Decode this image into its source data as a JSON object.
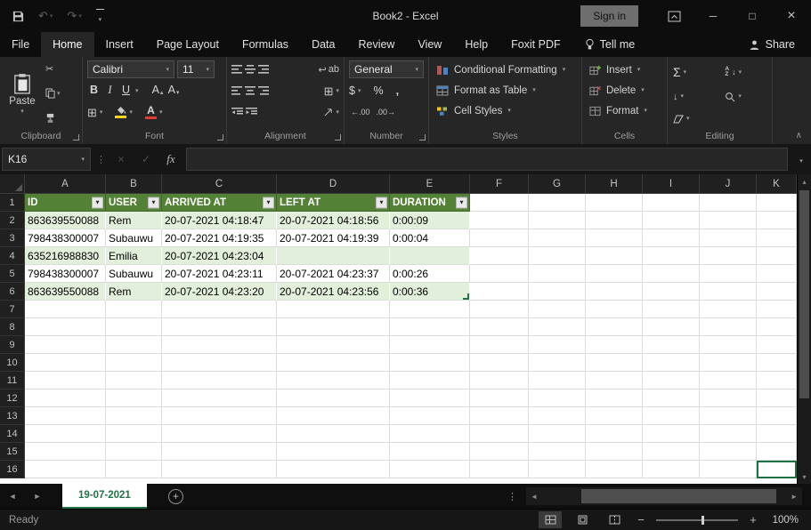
{
  "colors": {
    "excel_green": "#217346",
    "table_header_bg": "#538135",
    "table_band_bg": "#e2efda",
    "ribbon_bg": "#262626",
    "titlebar_bg": "#0d0d0d"
  },
  "icons": {
    "chevron_down": "▾",
    "chevron_up": "∧",
    "undo": "↶",
    "redo": "↷",
    "scissors": "✂",
    "dots_vertical": "⋮",
    "close": "×",
    "minimize": "─",
    "maximize": "□",
    "check": "✓",
    "sigma": "Σ",
    "tri_up": "▴",
    "tri_down": "▾",
    "tri_left": "◄",
    "tri_right": "►",
    "plus": "+",
    "minus": "−",
    "down_arrow": "↓",
    "return_arrow": "↩",
    "grid_square": "⊞",
    "fx": "fx"
  },
  "titlebar": {
    "title": "Book2 - Excel",
    "sign_in": "Sign in"
  },
  "menu": {
    "tabs": [
      "File",
      "Home",
      "Insert",
      "Page Layout",
      "Formulas",
      "Data",
      "Review",
      "View",
      "Help",
      "Foxit PDF"
    ],
    "active": "Home",
    "tell_me": "Tell me",
    "share": "Share"
  },
  "ribbon": {
    "clipboard": {
      "label": "Clipboard",
      "paste": "Paste"
    },
    "font": {
      "label": "Font",
      "family": "Calibri",
      "size": "11",
      "bold": "B",
      "italic": "I",
      "underline": "U",
      "grow": "A",
      "shrink": "A",
      "color_letter": "A"
    },
    "alignment": {
      "label": "Alignment",
      "wrap": "ab"
    },
    "number": {
      "label": "Number",
      "format": "General",
      "currency": "$",
      "percent": "%",
      "comma": ",",
      "increase_decimal": "←.00",
      "decrease_decimal": ".00→"
    },
    "styles": {
      "label": "Styles",
      "conditional": "Conditional Formatting",
      "format_table": "Format as Table",
      "cell_styles": "Cell Styles"
    },
    "cells": {
      "label": "Cells",
      "insert": "Insert",
      "delete": "Delete",
      "format": "Format"
    },
    "editing": {
      "label": "Editing",
      "sort_top": "A",
      "sort_bottom": "Z"
    }
  },
  "formula_bar": {
    "name_box": "K16",
    "value": ""
  },
  "grid": {
    "columns": [
      "A",
      "B",
      "C",
      "D",
      "E",
      "F",
      "G",
      "H",
      "I",
      "J",
      "K"
    ],
    "visible_rows": 16,
    "active_cell": "K16",
    "table": {
      "headers": [
        "ID",
        "USER",
        "ARRIVED AT",
        "LEFT AT",
        "DURATION"
      ],
      "rows": [
        [
          "863639550088",
          "Rem",
          "20-07-2021 04:18:47",
          "20-07-2021 04:18:56",
          "0:00:09"
        ],
        [
          "798438300007",
          "Subauwu",
          "20-07-2021 04:19:35",
          "20-07-2021 04:19:39",
          "0:00:04"
        ],
        [
          "635216988830",
          "Emilia",
          "20-07-2021 04:23:04",
          "",
          ""
        ],
        [
          "798438300007",
          "Subauwu",
          "20-07-2021 04:23:11",
          "20-07-2021 04:23:37",
          "0:00:26"
        ],
        [
          "863639550088",
          "Rem",
          "20-07-2021 04:23:20",
          "20-07-2021 04:23:56",
          "0:00:36"
        ]
      ]
    }
  },
  "sheet_bar": {
    "tabs": [
      "19-07-2021"
    ],
    "active_tab": "19-07-2021"
  },
  "status_bar": {
    "status": "Ready",
    "zoom": "100%"
  }
}
